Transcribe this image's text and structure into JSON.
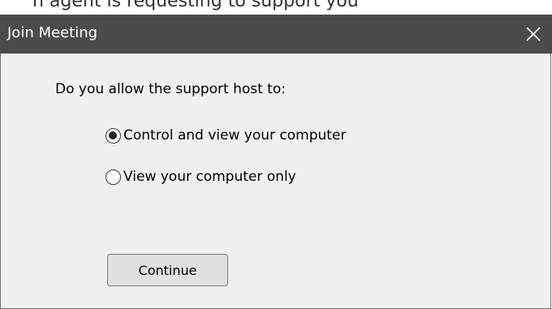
{
  "background_strip": {
    "text": "n agent is requesting to support you"
  },
  "dialog": {
    "title": "Join Meeting",
    "close_icon": "close-icon",
    "question": "Do you allow the support host to:",
    "options": [
      {
        "label": "Control and view your computer",
        "selected": true
      },
      {
        "label": "View your computer only",
        "selected": false
      }
    ],
    "continue_label": "Continue"
  },
  "colors": {
    "titlebar": "#4b4b4b",
    "dialog_background": "#f0f0f0",
    "button_background": "#e1e1e1"
  }
}
